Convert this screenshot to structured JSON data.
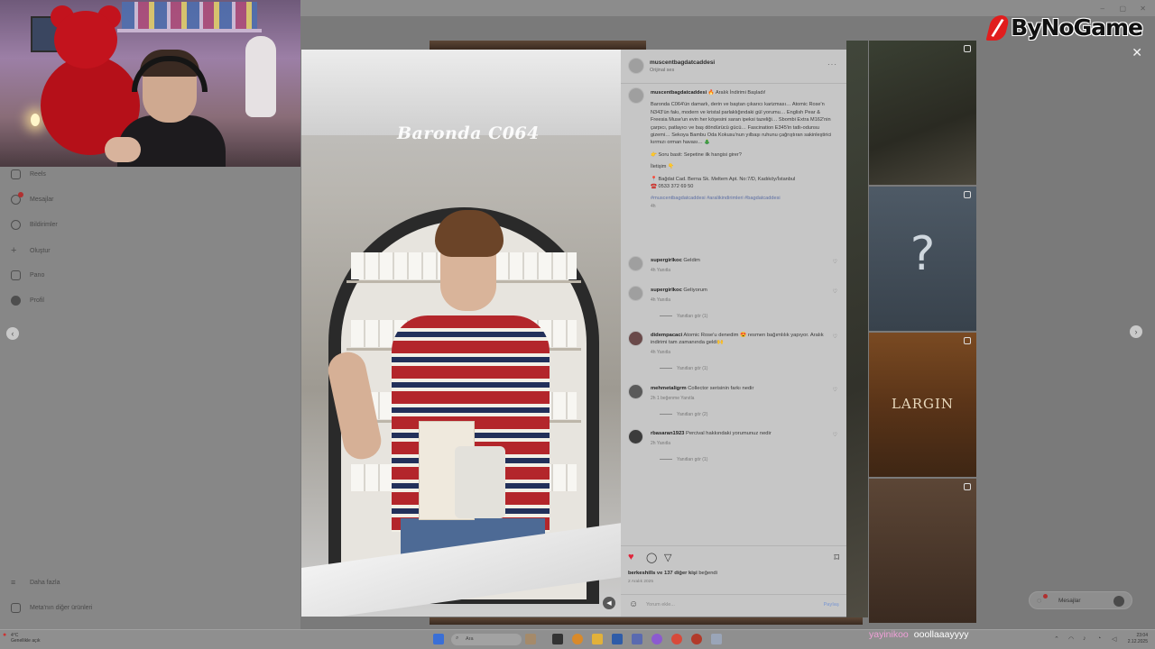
{
  "sidebar": {
    "items": [
      {
        "label": "Reels",
        "icon": "reels-icon"
      },
      {
        "label": "Mesajlar",
        "icon": "messenger-icon",
        "badge": true
      },
      {
        "label": "Bildirimler",
        "icon": "heart-icon"
      },
      {
        "label": "Oluştur",
        "icon": "plus-icon"
      },
      {
        "label": "Pano",
        "icon": "dashboard-icon"
      },
      {
        "label": "Profil",
        "icon": "profile-icon"
      }
    ],
    "more_label": "Daha fazla",
    "meta_label": "Meta'nın diğer ürünleri"
  },
  "post": {
    "overlay_text": "Baronda C064",
    "username": "muscentbagdatcaddesi",
    "subtitle": "Orijinal ses",
    "caption": {
      "user": "muscentbagdatcaddesi",
      "intro": "🔥 Aralık İndirimi Başladı!",
      "body": "Baronda C064'ün damarlı, derin ve baştan çıkarıcı karizması… Atomic Rose'n N343'ün fakı, modern ve kristal parlaklığındaki gül yorumu… English Pear & Freesia Muse'un evin her köşesini saran ipeksi tazeliği… Sbombi Extra M162'nin çarpıcı, patlayıcı ve baş döndürücü gücü… Fascination E345'in tatlı-odunsu gizemi… Sekoya Bambu Oda Kokusu'nun yılbaşı ruhunu çağrıştıran sakinleştirici kırmızı orman havası… 🎄",
      "question": "👉 Soru basit: Sepetine ilk hangisi girer?",
      "contact_label": "İletişim 👇",
      "address": "📍 Bağdat Cad. Berna Sk. Meltem Apt. No:7/D, Kadıköy/İstanbul",
      "phone": "☎️ 0533 372 69 50",
      "tags": "#muscentbagdatcaddesi #aralikindirimleri #bagdatcaddesi",
      "age": "4h"
    },
    "comments": [
      {
        "user": "supergirlkoc",
        "text": "Geldim",
        "meta": "4h  Yanıtla",
        "replies": ""
      },
      {
        "user": "supergirlkoc",
        "text": "Geliyorum",
        "meta": "4h  Yanıtla",
        "replies": "Yanıtları gör (1)"
      },
      {
        "user": "didempacaci",
        "text": "Atomic Rose'u denedim 😍 resmen bağımlılık yapıyor. Aralık indirimi tam zamanında geldi🙌",
        "meta": "4h  Yanıtla",
        "replies": "Yanıtları gör (1)"
      },
      {
        "user": "mehmetaligrm",
        "text": "Collector serisinin farkı nedir",
        "meta": "2h  1 beğenme  Yanıtla",
        "replies": "Yanıtları gör (2)"
      },
      {
        "user": "rbasaran1923",
        "text": "Percival hakkındaki yorumunuz nedir",
        "meta": "2h  Yanıtla",
        "replies": "Yanıtları gör (1)"
      }
    ],
    "likes_user": "berkeshills",
    "likes_rest": " ve 137 diğer kişi",
    "likes_suffix": " beğendi",
    "date": "2 Aralık 2025",
    "add_comment_placeholder": "Yorum ekle...",
    "post_label": "Paylaş"
  },
  "grid": {
    "tile_text": "LARGIN",
    "tile_glyph": "?"
  },
  "brand": {
    "name": "ByNoGame"
  },
  "messages_pill": {
    "label": "Mesajlar"
  },
  "taskbar": {
    "weather_line1": "4°C",
    "weather_line2": "Genellikle açık",
    "search_placeholder": "Ara",
    "time": "23:04",
    "date": "2.12.2025"
  },
  "chat": {
    "nick": "yayinikoo",
    "message": "ooollaaayyyy"
  },
  "colors": {
    "accent": "#e11d1d",
    "like": "#e0243a",
    "tag_link": "#5d6fa4"
  }
}
